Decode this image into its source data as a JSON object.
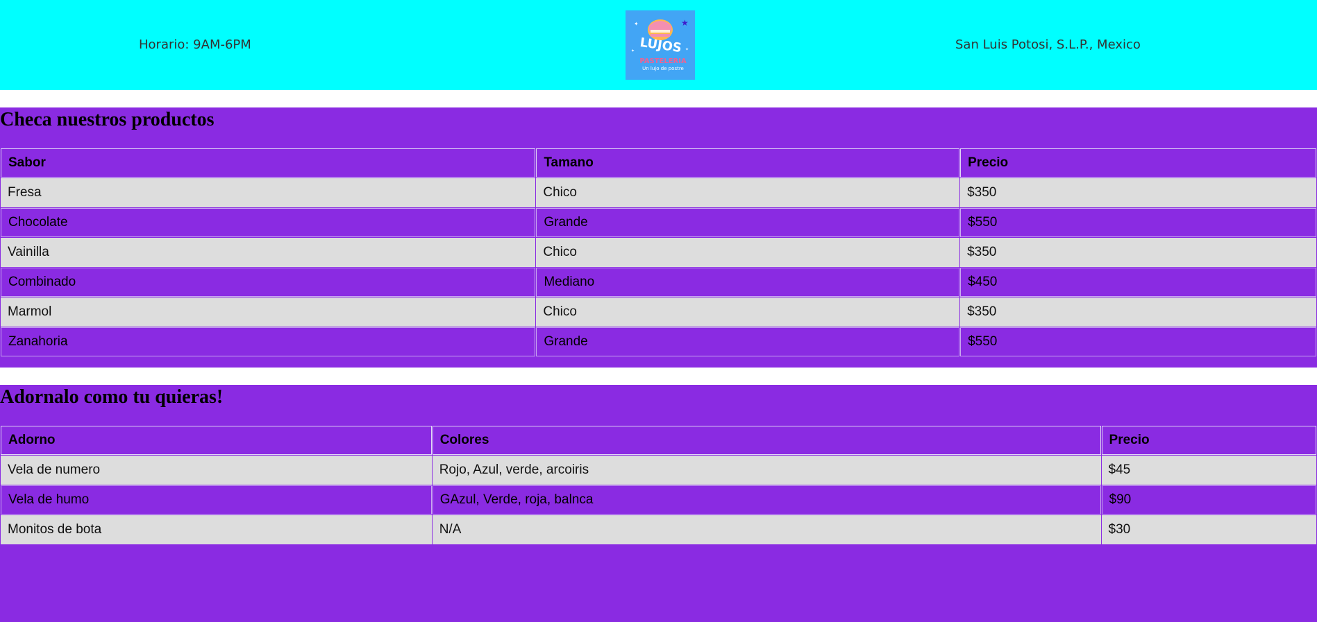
{
  "header": {
    "hours": "Horario: 9AM-6PM",
    "location": "San Luis Potosi, S.L.P., Mexico",
    "logo": {
      "name": "LUJOS",
      "subtitle": "PASTELERIA",
      "tagline": "Un lujo de postre",
      "bg_color": "#42a5f5"
    },
    "bg_color": "#00ffff"
  },
  "products": {
    "title": "Checa nuestros productos",
    "columns": [
      "Sabor",
      "Tamano",
      "Precio"
    ],
    "rows": [
      [
        "Fresa",
        "Chico",
        "$350"
      ],
      [
        "Chocolate",
        "Grande",
        "$550"
      ],
      [
        "Vainilla",
        "Chico",
        "$350"
      ],
      [
        "Combinado",
        "Mediano",
        "$450"
      ],
      [
        "Marmol",
        "Chico",
        "$350"
      ],
      [
        "Zanahoria",
        "Grande",
        "$550"
      ]
    ]
  },
  "decor": {
    "title": "Adornalo como tu quieras!",
    "columns": [
      "Adorno",
      "Colores",
      "Precio"
    ],
    "rows": [
      [
        "Vela de numero",
        "Rojo, Azul, verde, arcoiris",
        "$45"
      ],
      [
        "Vela de humo",
        "GAzul, Verde, roja, balnca",
        "$90"
      ],
      [
        "Monitos de bota",
        "N/A",
        "$30"
      ]
    ]
  },
  "colors": {
    "section_bg": "#8a2be2",
    "row_alt": "#dddddd"
  }
}
